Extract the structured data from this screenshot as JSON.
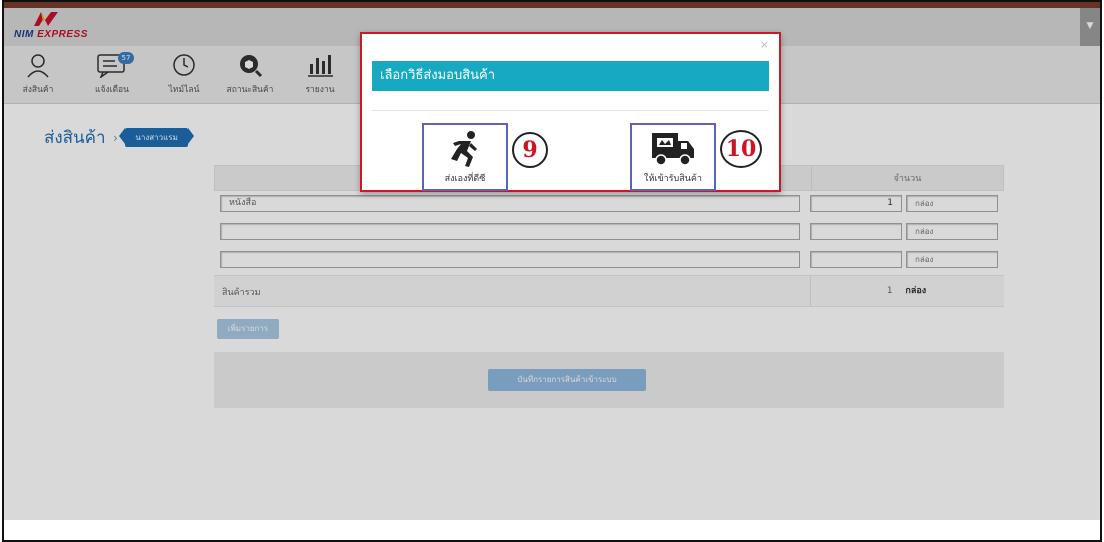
{
  "brand": {
    "logo_text": "NIM",
    "logo_text2": "EXPRESS"
  },
  "header": {
    "menu_caret": "▼"
  },
  "nav": {
    "items": [
      {
        "label": "ส่งสินค้า",
        "icon": "user-icon"
      },
      {
        "label": "แจ้งเตือน",
        "icon": "chat-icon",
        "badge": "57"
      },
      {
        "label": "ไทม์ไลน์",
        "icon": "clock-icon"
      },
      {
        "label": "สถานะสินค้า",
        "icon": "package-search-icon"
      },
      {
        "label": "รายงาน",
        "icon": "bar-chart-icon"
      }
    ]
  },
  "breadcrumb": {
    "title": "ส่งสินค้า",
    "sep": "›",
    "current": "นางสาวแรม"
  },
  "table": {
    "qty_header": "จำนวน",
    "rows": [
      {
        "item": "หนังสือ",
        "qty": "1",
        "unit": "กล่อง"
      },
      {
        "item": "",
        "qty": "",
        "unit": "กล่อง"
      },
      {
        "item": "",
        "qty": "",
        "unit": "กล่อง"
      }
    ],
    "total_label": "สินค้ารวม",
    "total_qty": "1",
    "total_unit": "กล่อง"
  },
  "buttons": {
    "add": "เพิ่มรายการ",
    "save": "บันทึกรายการสินค้าเข้าระบบ"
  },
  "modal": {
    "close": "×",
    "title": "เลือกวิธีส่งมอบสินค้า",
    "option1_label": "ส่งเองที่ดีซี",
    "option1_number": "9",
    "option2_label": "ให้เข้ารับสินค้า",
    "option2_number": "10"
  },
  "colors": {
    "accent": "#16a9c1",
    "brand_blue": "#1e6fb3",
    "annotation_red": "#d0142c"
  }
}
